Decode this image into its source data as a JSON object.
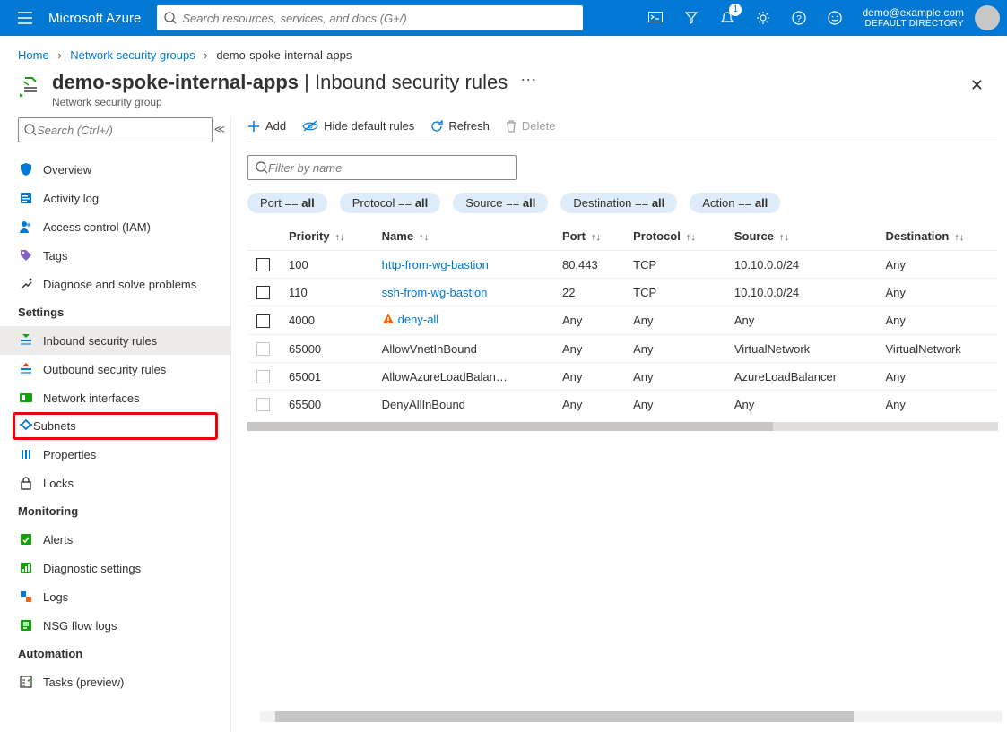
{
  "topbar": {
    "brand": "Microsoft Azure",
    "search_placeholder": "Search resources, services, and docs (G+/)",
    "notification_count": "1",
    "account_email": "demo@example.com",
    "account_dir": "DEFAULT DIRECTORY"
  },
  "breadcrumbs": {
    "items": [
      "Home",
      "Network security groups",
      "demo-spoke-internal-apps"
    ]
  },
  "header": {
    "title_main": "demo-spoke-internal-apps",
    "title_sep": " | ",
    "title_sub": "Inbound security rules",
    "subtitle": "Network security group"
  },
  "sidebar": {
    "search_placeholder": "Search (Ctrl+/)",
    "top_items": [
      {
        "icon": "shield",
        "label": "Overview"
      },
      {
        "icon": "activity",
        "label": "Activity log"
      },
      {
        "icon": "people",
        "label": "Access control (IAM)"
      },
      {
        "icon": "tag",
        "label": "Tags"
      },
      {
        "icon": "diagnose",
        "label": "Diagnose and solve problems"
      }
    ],
    "settings_label": "Settings",
    "settings_items": [
      {
        "icon": "inbound",
        "label": "Inbound security rules",
        "selected": true
      },
      {
        "icon": "outbound",
        "label": "Outbound security rules"
      },
      {
        "icon": "nic",
        "label": "Network interfaces"
      },
      {
        "icon": "subnet",
        "label": "Subnets",
        "highlight": true
      },
      {
        "icon": "props",
        "label": "Properties"
      },
      {
        "icon": "lock",
        "label": "Locks"
      }
    ],
    "monitoring_label": "Monitoring",
    "monitoring_items": [
      {
        "icon": "alert",
        "label": "Alerts"
      },
      {
        "icon": "diagset",
        "label": "Diagnostic settings"
      },
      {
        "icon": "logs",
        "label": "Logs"
      },
      {
        "icon": "flow",
        "label": "NSG flow logs"
      }
    ],
    "automation_label": "Automation",
    "automation_items": [
      {
        "icon": "tasks",
        "label": "Tasks (preview)"
      }
    ]
  },
  "toolbar": {
    "add": "Add",
    "hide": "Hide default rules",
    "refresh": "Refresh",
    "delete": "Delete"
  },
  "filter_placeholder": "Filter by name",
  "pills": [
    {
      "key": "Port",
      "val": "all"
    },
    {
      "key": "Protocol",
      "val": "all"
    },
    {
      "key": "Source",
      "val": "all"
    },
    {
      "key": "Destination",
      "val": "all"
    },
    {
      "key": "Action",
      "val": "all"
    }
  ],
  "columns": [
    "Priority",
    "Name",
    "Port",
    "Protocol",
    "Source",
    "Destination"
  ],
  "rules": [
    {
      "priority": "100",
      "name": "http-from-wg-bastion",
      "link": true,
      "warn": false,
      "port": "80,443",
      "protocol": "TCP",
      "source": "10.10.0.0/24",
      "destination": "Any",
      "default": false
    },
    {
      "priority": "110",
      "name": "ssh-from-wg-bastion",
      "link": true,
      "warn": false,
      "port": "22",
      "protocol": "TCP",
      "source": "10.10.0.0/24",
      "destination": "Any",
      "default": false
    },
    {
      "priority": "4000",
      "name": "deny-all",
      "link": true,
      "warn": true,
      "port": "Any",
      "protocol": "Any",
      "source": "Any",
      "destination": "Any",
      "default": false
    },
    {
      "priority": "65000",
      "name": "AllowVnetInBound",
      "link": false,
      "warn": false,
      "port": "Any",
      "protocol": "Any",
      "source": "VirtualNetwork",
      "destination": "VirtualNetwork",
      "default": true
    },
    {
      "priority": "65001",
      "name": "AllowAzureLoadBalan…",
      "link": false,
      "warn": false,
      "port": "Any",
      "protocol": "Any",
      "source": "AzureLoadBalancer",
      "destination": "Any",
      "default": true
    },
    {
      "priority": "65500",
      "name": "DenyAllInBound",
      "link": false,
      "warn": false,
      "port": "Any",
      "protocol": "Any",
      "source": "Any",
      "destination": "Any",
      "default": true
    }
  ]
}
